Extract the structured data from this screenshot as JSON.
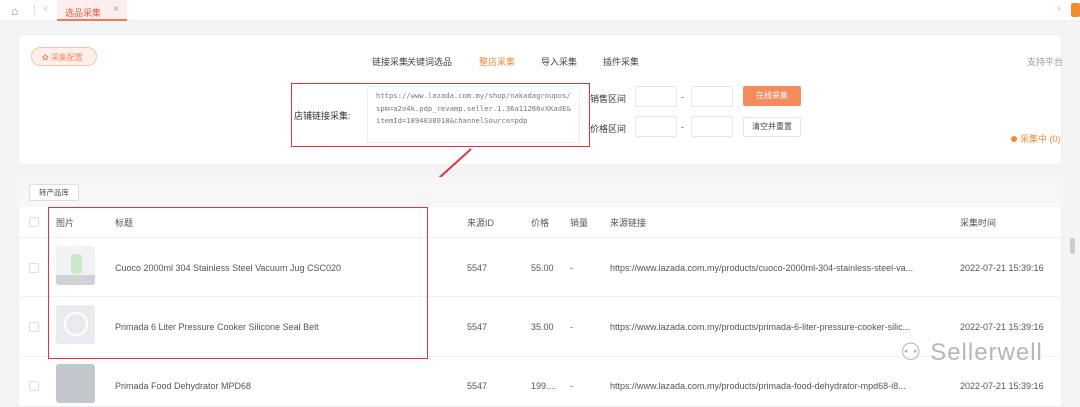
{
  "topbar": {
    "tab_label": "选品采集",
    "home_icon": "home-icon",
    "close_icon": "close-icon"
  },
  "config_button": "采集配置",
  "nav_tabs": [
    {
      "label": "链接采集"
    },
    {
      "label": "关键词选品"
    },
    {
      "label": "整店采集",
      "active": true
    },
    {
      "label": "导入采集"
    },
    {
      "label": "插件采集"
    }
  ],
  "support_platform": "支持平台",
  "form": {
    "store_link_label": "店铺链接采集:",
    "store_link_value": "https://www.lazada.com.my/shop/nakadagroupos/spm=a2o4k.pdp_revamp.seller.1.36a11266vXKadE&itemId=1894038018&channelSource=pdp",
    "sales_range_label": "销售区间",
    "price_range_label": "价格区间",
    "range_sep": "-",
    "collect_button": "在线采集",
    "reset_button": "清空并重置",
    "status": "采集中 (0)"
  },
  "accent_color": "#f58c5e",
  "toolbar": {
    "transfer_button": "转产品库"
  },
  "table": {
    "headers": [
      "图片",
      "标题",
      "来源ID",
      "价格",
      "销量",
      "来源链接",
      "采集时间"
    ],
    "rows": [
      {
        "title": "Cuoco 2000ml 304 Stainless Steel Vacuum Jug CSC020",
        "source_id": "5547",
        "price": "55.00",
        "sales": "-",
        "link": "https://www.lazada.com.my/products/cuoco-2000ml-304-stainless-steel-va...",
        "time": "2022-07-21 15:39:16"
      },
      {
        "title": "Primada 6 Liter Pressure Cooker Silicone Seal Belt",
        "source_id": "5547",
        "price": "35.00",
        "sales": "-",
        "link": "https://www.lazada.com.my/products/primada-6-liter-pressure-cooker-silic...",
        "time": "2022-07-21 15:39:16"
      },
      {
        "title": "Primada Food Dehydrator MPD68",
        "source_id": "5547",
        "price": "199....",
        "sales": "-",
        "link": "https://www.lazada.com.my/products/primada-food-dehydrator-mpd68-i8...",
        "time": "2022-07-21 15:39:16"
      }
    ]
  },
  "watermark": "Sellerwell"
}
